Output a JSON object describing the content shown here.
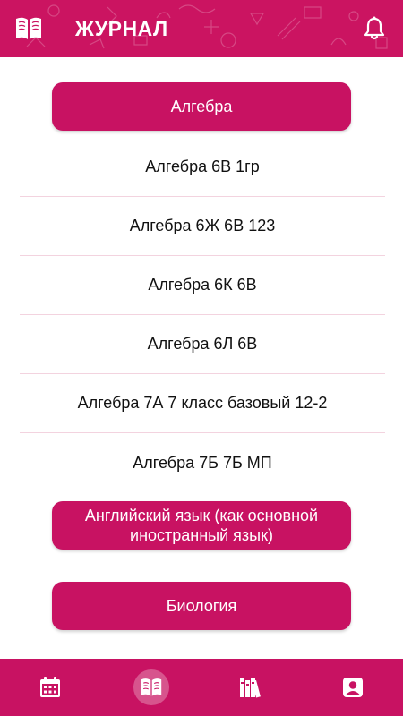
{
  "header": {
    "title": "ЖУРНАЛ",
    "logo_icon": "open-book-icon",
    "notification_icon": "bell-icon",
    "bg_color": "#cb1461"
  },
  "subjects": [
    {
      "label": "Алгебра",
      "classes": [
        "Алгебра 6В 1гр",
        "Алгебра 6Ж 6В 123",
        "Алгебра 6К 6В",
        "Алгебра 6Л 6В",
        "Алгебра 7А 7 класс базовый 12-2",
        "Алгебра 7Б 7Б МП"
      ]
    },
    {
      "label": "Английский язык (как основной иностранный язык)"
    },
    {
      "label": "Биология"
    }
  ],
  "bottom_nav": {
    "items": [
      {
        "icon": "calendar-icon"
      },
      {
        "icon": "journal-book-icon",
        "active": true
      },
      {
        "icon": "books-library-icon"
      },
      {
        "icon": "profile-icon"
      }
    ]
  },
  "colors": {
    "accent": "#c81262",
    "divider": "#f3d3df"
  }
}
